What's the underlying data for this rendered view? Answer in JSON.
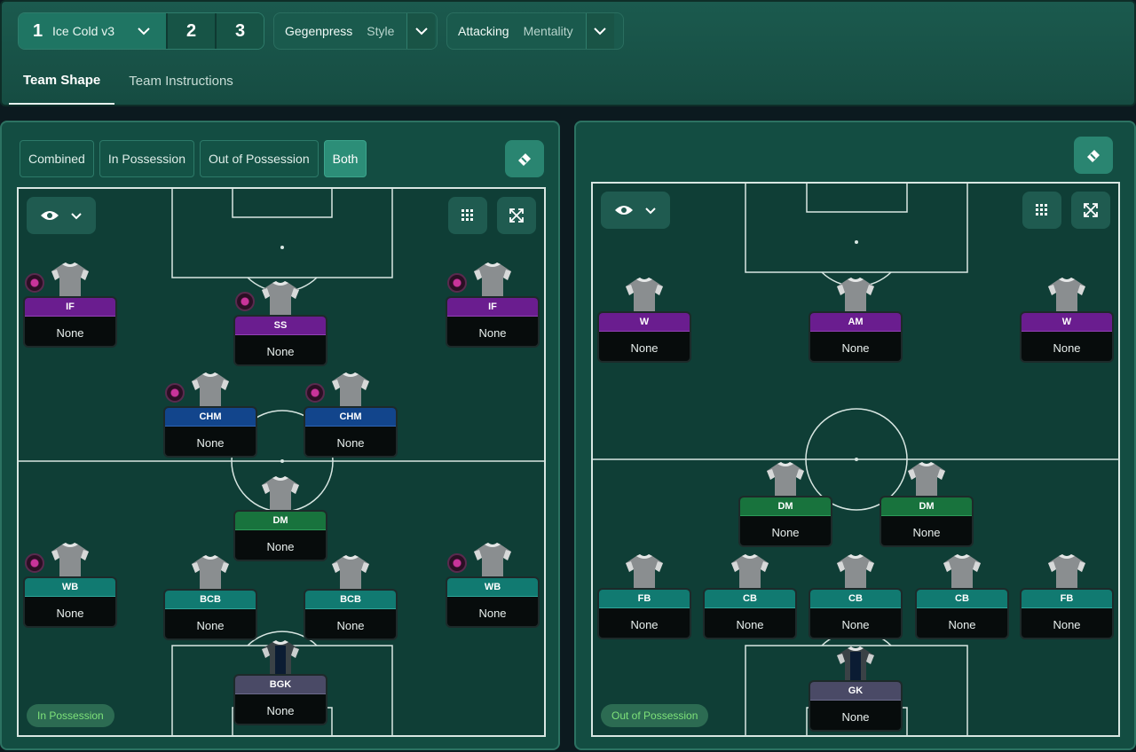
{
  "tactic": {
    "number": "1",
    "name": "Ice Cold v3",
    "slots": [
      "2",
      "3"
    ]
  },
  "style": {
    "value": "Gegenpress",
    "label": "Style"
  },
  "mentality": {
    "value": "Attacking",
    "label": "Mentality"
  },
  "tabs": [
    "Team Shape",
    "Team Instructions"
  ],
  "views": [
    "Combined",
    "In Possession",
    "Out of Possession",
    "Both"
  ],
  "left_phase": "In Possession",
  "right_phase": "Out of Possession",
  "left_players": [
    {
      "role": "IF",
      "name": "None"
    },
    {
      "role": "SS",
      "name": "None"
    },
    {
      "role": "IF",
      "name": "None"
    },
    {
      "role": "CHM",
      "name": "None"
    },
    {
      "role": "CHM",
      "name": "None"
    },
    {
      "role": "DM",
      "name": "None"
    },
    {
      "role": "WB",
      "name": "None"
    },
    {
      "role": "BCB",
      "name": "None"
    },
    {
      "role": "BCB",
      "name": "None"
    },
    {
      "role": "WB",
      "name": "None"
    },
    {
      "role": "BGK",
      "name": "None"
    }
  ],
  "right_players": [
    {
      "role": "W",
      "name": "None"
    },
    {
      "role": "AM",
      "name": "None"
    },
    {
      "role": "W",
      "name": "None"
    },
    {
      "role": "DM",
      "name": "None"
    },
    {
      "role": "DM",
      "name": "None"
    },
    {
      "role": "FB",
      "name": "None"
    },
    {
      "role": "CB",
      "name": "None"
    },
    {
      "role": "CB",
      "name": "None"
    },
    {
      "role": "CB",
      "name": "None"
    },
    {
      "role": "FB",
      "name": "None"
    },
    {
      "role": "GK",
      "name": "None"
    }
  ],
  "icons": {
    "chevron": "chevron-down-icon",
    "eye": "eye-icon",
    "grid": "grid-icon",
    "expand": "expand-icon",
    "eraser": "eraser-icon"
  },
  "colors": {
    "attacker_role": "#6a1d8f",
    "midfield_role": "#12458c",
    "dm_role": "#18733d",
    "defender_role": "#117a71",
    "keeper_role": "#4a4a66",
    "accent": "#2c8e78"
  }
}
